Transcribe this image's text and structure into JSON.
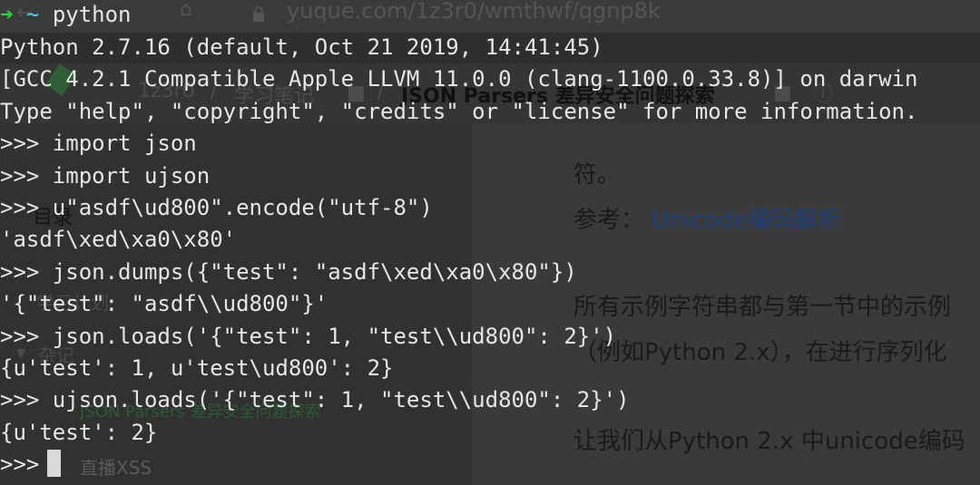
{
  "browser": {
    "url": "yuque.com/1z3r0/wmthwf/qgnp8k",
    "breadcrumb_user": "1z3r0",
    "breadcrumb_sep": "/",
    "breadcrumb_book": "学习笔记",
    "breadcrumb_doc": "JSON Parsers 差异安全问题探索",
    "info_icon": "info-icon"
  },
  "sidebar": {
    "toc_title": "目录",
    "item_collapsed": "学习计划",
    "item_group": "杂记",
    "item_doc": "JSON Parsers 差异安全问题探索",
    "item_live": "直播XSS"
  },
  "content": {
    "p1": "符。",
    "p2_label": "参考：",
    "p2_link": "Unicode编码解析",
    "p3": "所有示例字符串都与第一节中的示例",
    "p4": "（例如Python 2.x），在进行序列化",
    "p5": "让我们从Python 2.x 中unicode编码"
  },
  "terminal": {
    "prompt_arrow": "➜",
    "prompt_tilde": "~",
    "command": "python",
    "lines": [
      "Python 2.7.16 (default, Oct 21 2019, 14:41:45)",
      "[GCC 4.2.1 Compatible Apple LLVM 11.0.0 (clang-1100.0.33.8)] on darwin",
      "Type \"help\", \"copyright\", \"credits\" or \"license\" for more information.",
      ">>> import json",
      ">>> import ujson",
      ">>> u\"asdf\\ud800\".encode(\"utf-8\")",
      "'asdf\\xed\\xa0\\x80'",
      ">>> json.dumps({\"test\": \"asdf\\xed\\xa0\\x80\"})",
      "'{\"test\": \"asdf\\\\ud800\"}'",
      ">>> json.loads('{\"test\": 1, \"test\\\\ud800\": 2}')",
      "{u'test': 1, u'test\\ud800': 2}",
      ">>> ujson.loads('{\"test\": 1, \"test\\\\ud800\": 2}')",
      "{u'test': 2}"
    ],
    "final_prompt": ">>>"
  }
}
